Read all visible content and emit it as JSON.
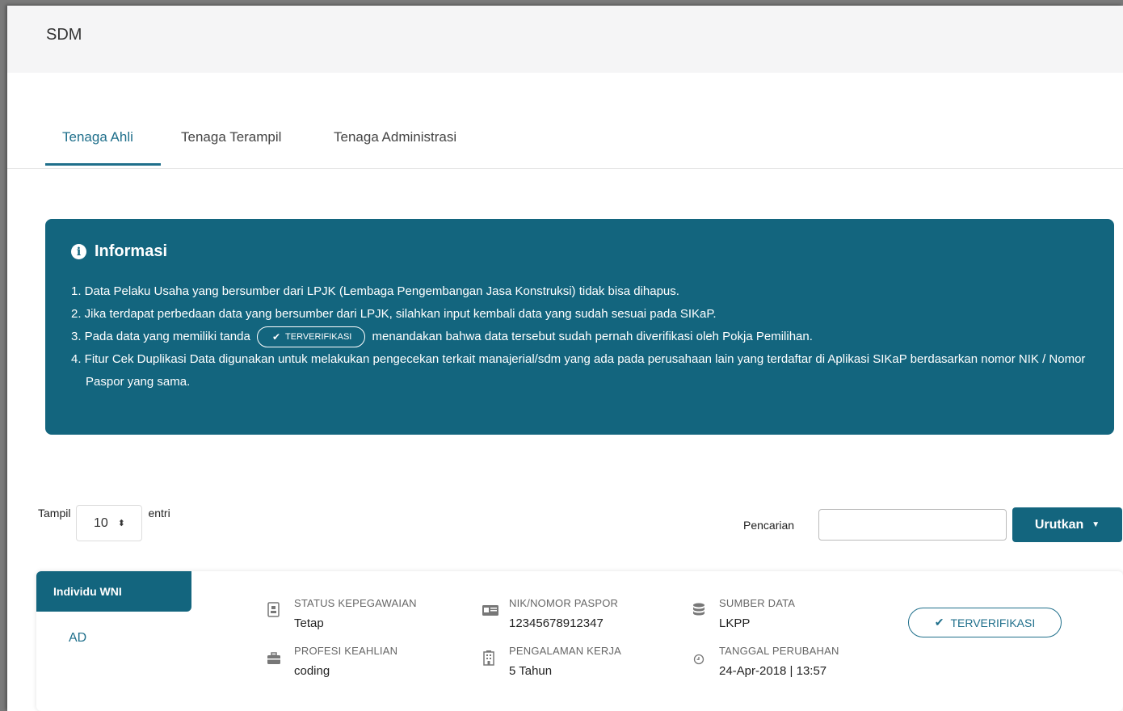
{
  "header": {
    "title": "SDM"
  },
  "tabs": [
    {
      "label": "Tenaga Ahli",
      "active": true
    },
    {
      "label": "Tenaga Terampil",
      "active": false
    },
    {
      "label": "Tenaga Administrasi",
      "active": false
    }
  ],
  "info": {
    "title": "Informasi",
    "item1": "1. Data Pelaku Usaha yang bersumber dari LPJK (Lembaga Pengembangan Jasa Konstruksi) tidak bisa dihapus.",
    "item2": "2. Jika terdapat perbedaan data yang bersumber dari LPJK, silahkan input kembali data yang sudah sesuai pada SIKaP.",
    "item3_before": "3. Pada data yang memiliki tanda",
    "item3_badge": "TERVERIFIKASI",
    "item3_after": "menandakan bahwa data tersebut sudah pernah diverifikasi oleh Pokja Pemilihan.",
    "item4": "4. Fitur Cek Duplikasi Data digunakan untuk melakukan pengecekan terkait manajerial/sdm yang ada pada perusahaan lain yang terdaftar di Aplikasi SIKaP berdasarkan nomor NIK / Nomor Paspor yang sama."
  },
  "table_controls": {
    "show_label": "Tampil",
    "page_size": "10",
    "entries_label": "entri",
    "search_label": "Pencarian",
    "search_value": "",
    "sort_label": "Urutkan"
  },
  "record": {
    "type_label": "Individu WNI",
    "name": "AD",
    "fields": {
      "status": {
        "label": "STATUS KEPEGAWAIAN",
        "value": "Tetap",
        "icon": "id-badge-icon"
      },
      "profesi": {
        "label": "PROFESI KEAHLIAN",
        "value": "coding",
        "icon": "briefcase-icon"
      },
      "nik": {
        "label": "NIK/NOMOR PASPOR",
        "value": "12345678912347",
        "icon": "id-card-icon"
      },
      "pengalaman": {
        "label": "PENGALAMAN KERJA",
        "value": "5 Tahun",
        "icon": "building-icon"
      },
      "sumber": {
        "label": "SUMBER DATA",
        "value": "LKPP",
        "icon": "database-icon"
      },
      "tanggal": {
        "label": "TANGGAL PERUBAHAN",
        "value": "24-Apr-2018 | 13:57",
        "icon": "clock-icon"
      }
    },
    "verified_label": "TERVERIFIKASI"
  },
  "colors": {
    "primary": "#13657e",
    "accent_text": "#1f6f8b"
  }
}
